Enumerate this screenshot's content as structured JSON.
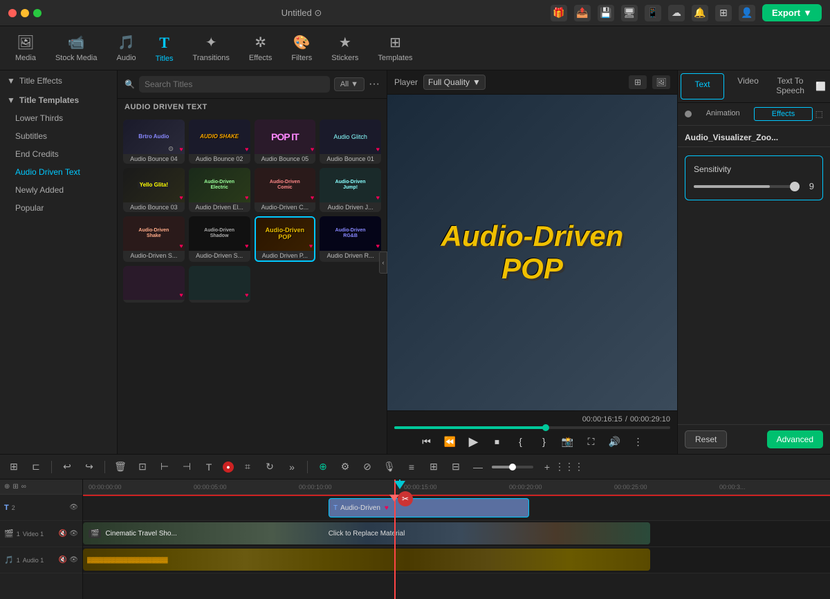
{
  "titlebar": {
    "title": "Untitled",
    "export_label": "Export"
  },
  "toolbar": {
    "items": [
      {
        "id": "media",
        "icon": "🖼",
        "label": "Media"
      },
      {
        "id": "stock-media",
        "icon": "📹",
        "label": "Stock Media"
      },
      {
        "id": "audio",
        "icon": "🎵",
        "label": "Audio"
      },
      {
        "id": "titles",
        "icon": "T",
        "label": "Titles",
        "active": true
      },
      {
        "id": "transitions",
        "icon": "✦",
        "label": "Transitions"
      },
      {
        "id": "effects",
        "icon": "✲",
        "label": "Effects"
      },
      {
        "id": "filters",
        "icon": "🎨",
        "label": "Filters"
      },
      {
        "id": "stickers",
        "icon": "★",
        "label": "Stickers"
      },
      {
        "id": "templates",
        "icon": "⊞",
        "label": "Templates"
      }
    ]
  },
  "left_panel": {
    "title": "Title Effects",
    "sections": [
      {
        "label": "Title Templates",
        "items": [
          {
            "label": "Lower Thirds",
            "active": false
          },
          {
            "label": "Subtitles",
            "active": false
          },
          {
            "label": "End Credits",
            "active": false
          },
          {
            "label": "Audio Driven Text",
            "active": true
          },
          {
            "label": "Newly Added",
            "active": false
          },
          {
            "label": "Popular",
            "active": false
          }
        ]
      }
    ]
  },
  "middle_panel": {
    "search_placeholder": "Search Titles",
    "filter_label": "All",
    "section_title": "AUDIO DRIVEN TEXT",
    "templates": [
      {
        "id": "bounce04",
        "name": "Audio Bounce 04",
        "selected": false
      },
      {
        "id": "bounce02",
        "name": "Audio Bounce 02",
        "selected": false
      },
      {
        "id": "bounce05",
        "name": "Audio Bounce 05",
        "selected": false
      },
      {
        "id": "bounce01",
        "name": "Audio Bounce 01",
        "selected": false
      },
      {
        "id": "bounce03",
        "name": "Audio Bounce 03",
        "selected": false
      },
      {
        "id": "driven-el",
        "name": "Audio Driven El...",
        "selected": false
      },
      {
        "id": "driven-c",
        "name": "Audio-Driven C...",
        "selected": false
      },
      {
        "id": "driven-j",
        "name": "Audio Driven J...",
        "selected": false
      },
      {
        "id": "driven-s1",
        "name": "Audio-Driven S...",
        "selected": false
      },
      {
        "id": "driven-s2",
        "name": "Audio-Driven S...",
        "selected": false
      },
      {
        "id": "driven-pop",
        "name": "Audio Driven P...",
        "selected": true
      },
      {
        "id": "driven-r",
        "name": "Audio Driven R...",
        "selected": false
      }
    ],
    "partial_templates": [
      {
        "id": "partial1",
        "name": ""
      },
      {
        "id": "partial2",
        "name": ""
      },
      {
        "id": "partial3",
        "name": ""
      },
      {
        "id": "partial4",
        "name": ""
      }
    ]
  },
  "preview": {
    "player_label": "Player",
    "quality": "Full Quality",
    "video_text_line1": "Audio-Driven",
    "video_text_line2": "POP",
    "current_time": "00:00:16:15",
    "total_time": "00:00:29:10",
    "progress_percent": 56
  },
  "right_panel": {
    "tabs": [
      {
        "label": "Text",
        "active": true
      },
      {
        "label": "Video",
        "active": false
      },
      {
        "label": "Text To Speech",
        "active": false
      }
    ],
    "sub_tabs": [
      {
        "label": "Animation",
        "active": false
      },
      {
        "label": "Effects",
        "active": true
      }
    ],
    "effect_name": "Audio_Visualizer_Zoo...",
    "sensitivity_label": "Sensitivity",
    "sensitivity_value": "9",
    "reset_label": "Reset",
    "advanced_label": "Advanced"
  },
  "timeline": {
    "tracks": [
      {
        "num": "2",
        "type": "text",
        "icon": "T"
      },
      {
        "num": "1",
        "type": "video",
        "icon": "🎬"
      },
      {
        "num": "1",
        "type": "audio",
        "icon": "🎵"
      }
    ],
    "time_markers": [
      "00:00:00:00",
      "00:00:05:00",
      "00:00:10:00",
      "00:00:15:00",
      "00:00:20:00",
      "00:00:25:00",
      "00:00:3..."
    ],
    "audio_clip_label": "Audio-Driven",
    "video_clip_label": "Click to Replace Material",
    "cinematic_label": "Cinematic Travel Sho..."
  }
}
